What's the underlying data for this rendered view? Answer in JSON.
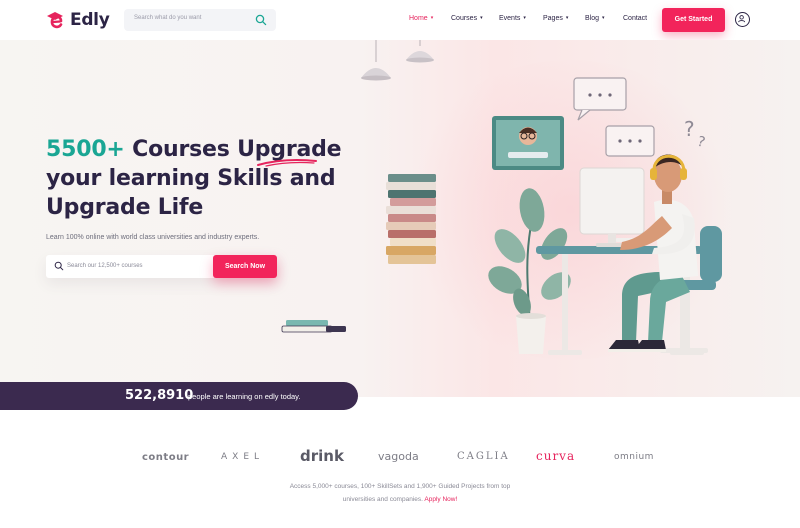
{
  "brand": {
    "name": "Edly",
    "accent": "#f2245b",
    "teal": "#1aa694",
    "dark": "#2c2445"
  },
  "header": {
    "search_placeholder": "Search what do you want",
    "nav": [
      {
        "label": "Home",
        "caret": "▾",
        "active": true
      },
      {
        "label": "Courses",
        "caret": "▾",
        "active": false
      },
      {
        "label": "Events",
        "caret": "▾",
        "active": false
      },
      {
        "label": "Pages",
        "caret": "▾",
        "active": false
      },
      {
        "label": "Blog",
        "caret": "▾",
        "active": false
      },
      {
        "label": "Contact",
        "caret": "",
        "active": false
      }
    ],
    "cta_label": "Get Started",
    "icons": {
      "search": "search-icon",
      "user": "user-icon"
    }
  },
  "hero": {
    "headline_accent": "5500+",
    "headline_line1_rest": " Courses Upgrade",
    "headline_line2": "your learning Skills and",
    "headline_line3": "Upgrade Life",
    "subtext": "Learn 100% online with world class universities and industry experts.",
    "search_placeholder": "Search our 12,500+ courses",
    "search_button": "Search Now"
  },
  "learners": {
    "count": "522,8910",
    "text": "people are learning on edly today."
  },
  "brands": [
    "contour",
    "AXEL",
    "drink",
    "vagoda",
    "CAGLIA",
    "curva",
    "omnium"
  ],
  "footer_text": {
    "line1": "Access 5,000+ courses, 100+ SkillSets and 1,900+ Guided Projects from top",
    "line2": "universities and companies.",
    "link": "Apply Now!"
  }
}
